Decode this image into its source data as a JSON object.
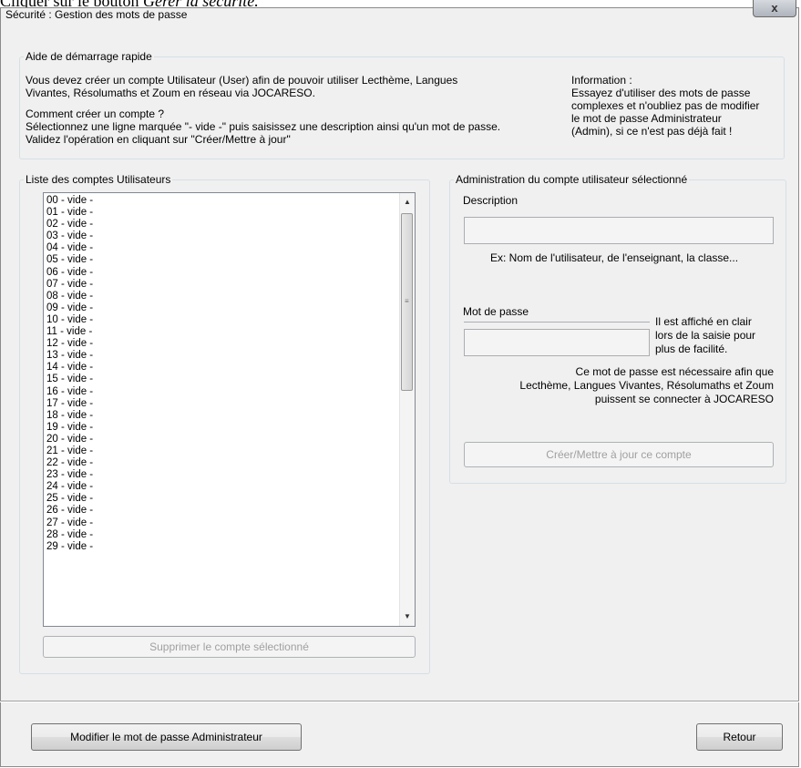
{
  "doc_caption": {
    "prefix": "Cliquer sur le bouton ",
    "emphasis": "Gérer la sécurité."
  },
  "window": {
    "title": "Sécurité : Gestion des mots de passe",
    "close_glyph": "x"
  },
  "quickstart": {
    "legend": "Aide de démarrage rapide",
    "line1": "Vous devez créer un compte Utilisateur (User) afin de pouvoir utiliser Lecthème, Langues",
    "line2": "Vivantes, Résolumaths et Zoum en réseau via JOCARESO.",
    "line3": "Comment créer un compte ?",
    "line4": "Sélectionnez une ligne marquée \"- vide -\" puis saisissez une description ainsi qu'un mot de passe.",
    "line5": "Validez l'opération en cliquant sur \"Créer/Mettre à jour\"",
    "info1": "Information :",
    "info2": "Essayez d'utiliser des mots de passe",
    "info3": "complexes et n'oubliez pas de modifier",
    "info4": "le mot de passe Administrateur",
    "info5": "(Admin), si ce n'est pas déjà fait !"
  },
  "accounts": {
    "legend": "Liste des comptes Utilisateurs",
    "items": [
      "00 - vide -",
      "01 - vide -",
      "02 - vide -",
      "03 - vide -",
      "04 - vide -",
      "05 - vide -",
      "06 - vide -",
      "07 - vide -",
      "08 - vide -",
      "09 - vide -",
      "10 - vide -",
      "11 - vide -",
      "12 - vide -",
      "13 - vide -",
      "14 - vide -",
      "15 - vide -",
      "16 - vide -",
      "17 - vide -",
      "18 - vide -",
      "19 - vide -",
      "20 - vide -",
      "21 - vide -",
      "22 - vide -",
      "23 - vide -",
      "24 - vide -",
      "25 - vide -",
      "26 - vide -",
      "27 - vide -",
      "28 - vide -",
      "29 - vide -"
    ],
    "delete_button": "Supprimer le compte sélectionné"
  },
  "admin": {
    "legend": "Administration du compte utilisateur sélectionné",
    "description_label": "Description",
    "description_value": "",
    "description_hint": "Ex: Nom de l'utilisateur, de l'enseignant, la classe...",
    "password_label": "Mot de passe",
    "password_value": "",
    "password_hint1": "Il est affiché en clair",
    "password_hint2": "lors de la saisie pour",
    "password_hint3": "plus de facilité.",
    "required1": "Ce mot de passe est nécessaire afin que",
    "required2": "Lecthème, Langues Vivantes, Résolumaths et Zoum",
    "required3": "puissent se connecter à JOCARESO",
    "submit_button": "Créer/Mettre à jour ce compte"
  },
  "footer": {
    "admin_password_button": "Modifier le mot de passe Administrateur",
    "back_button": "Retour"
  }
}
